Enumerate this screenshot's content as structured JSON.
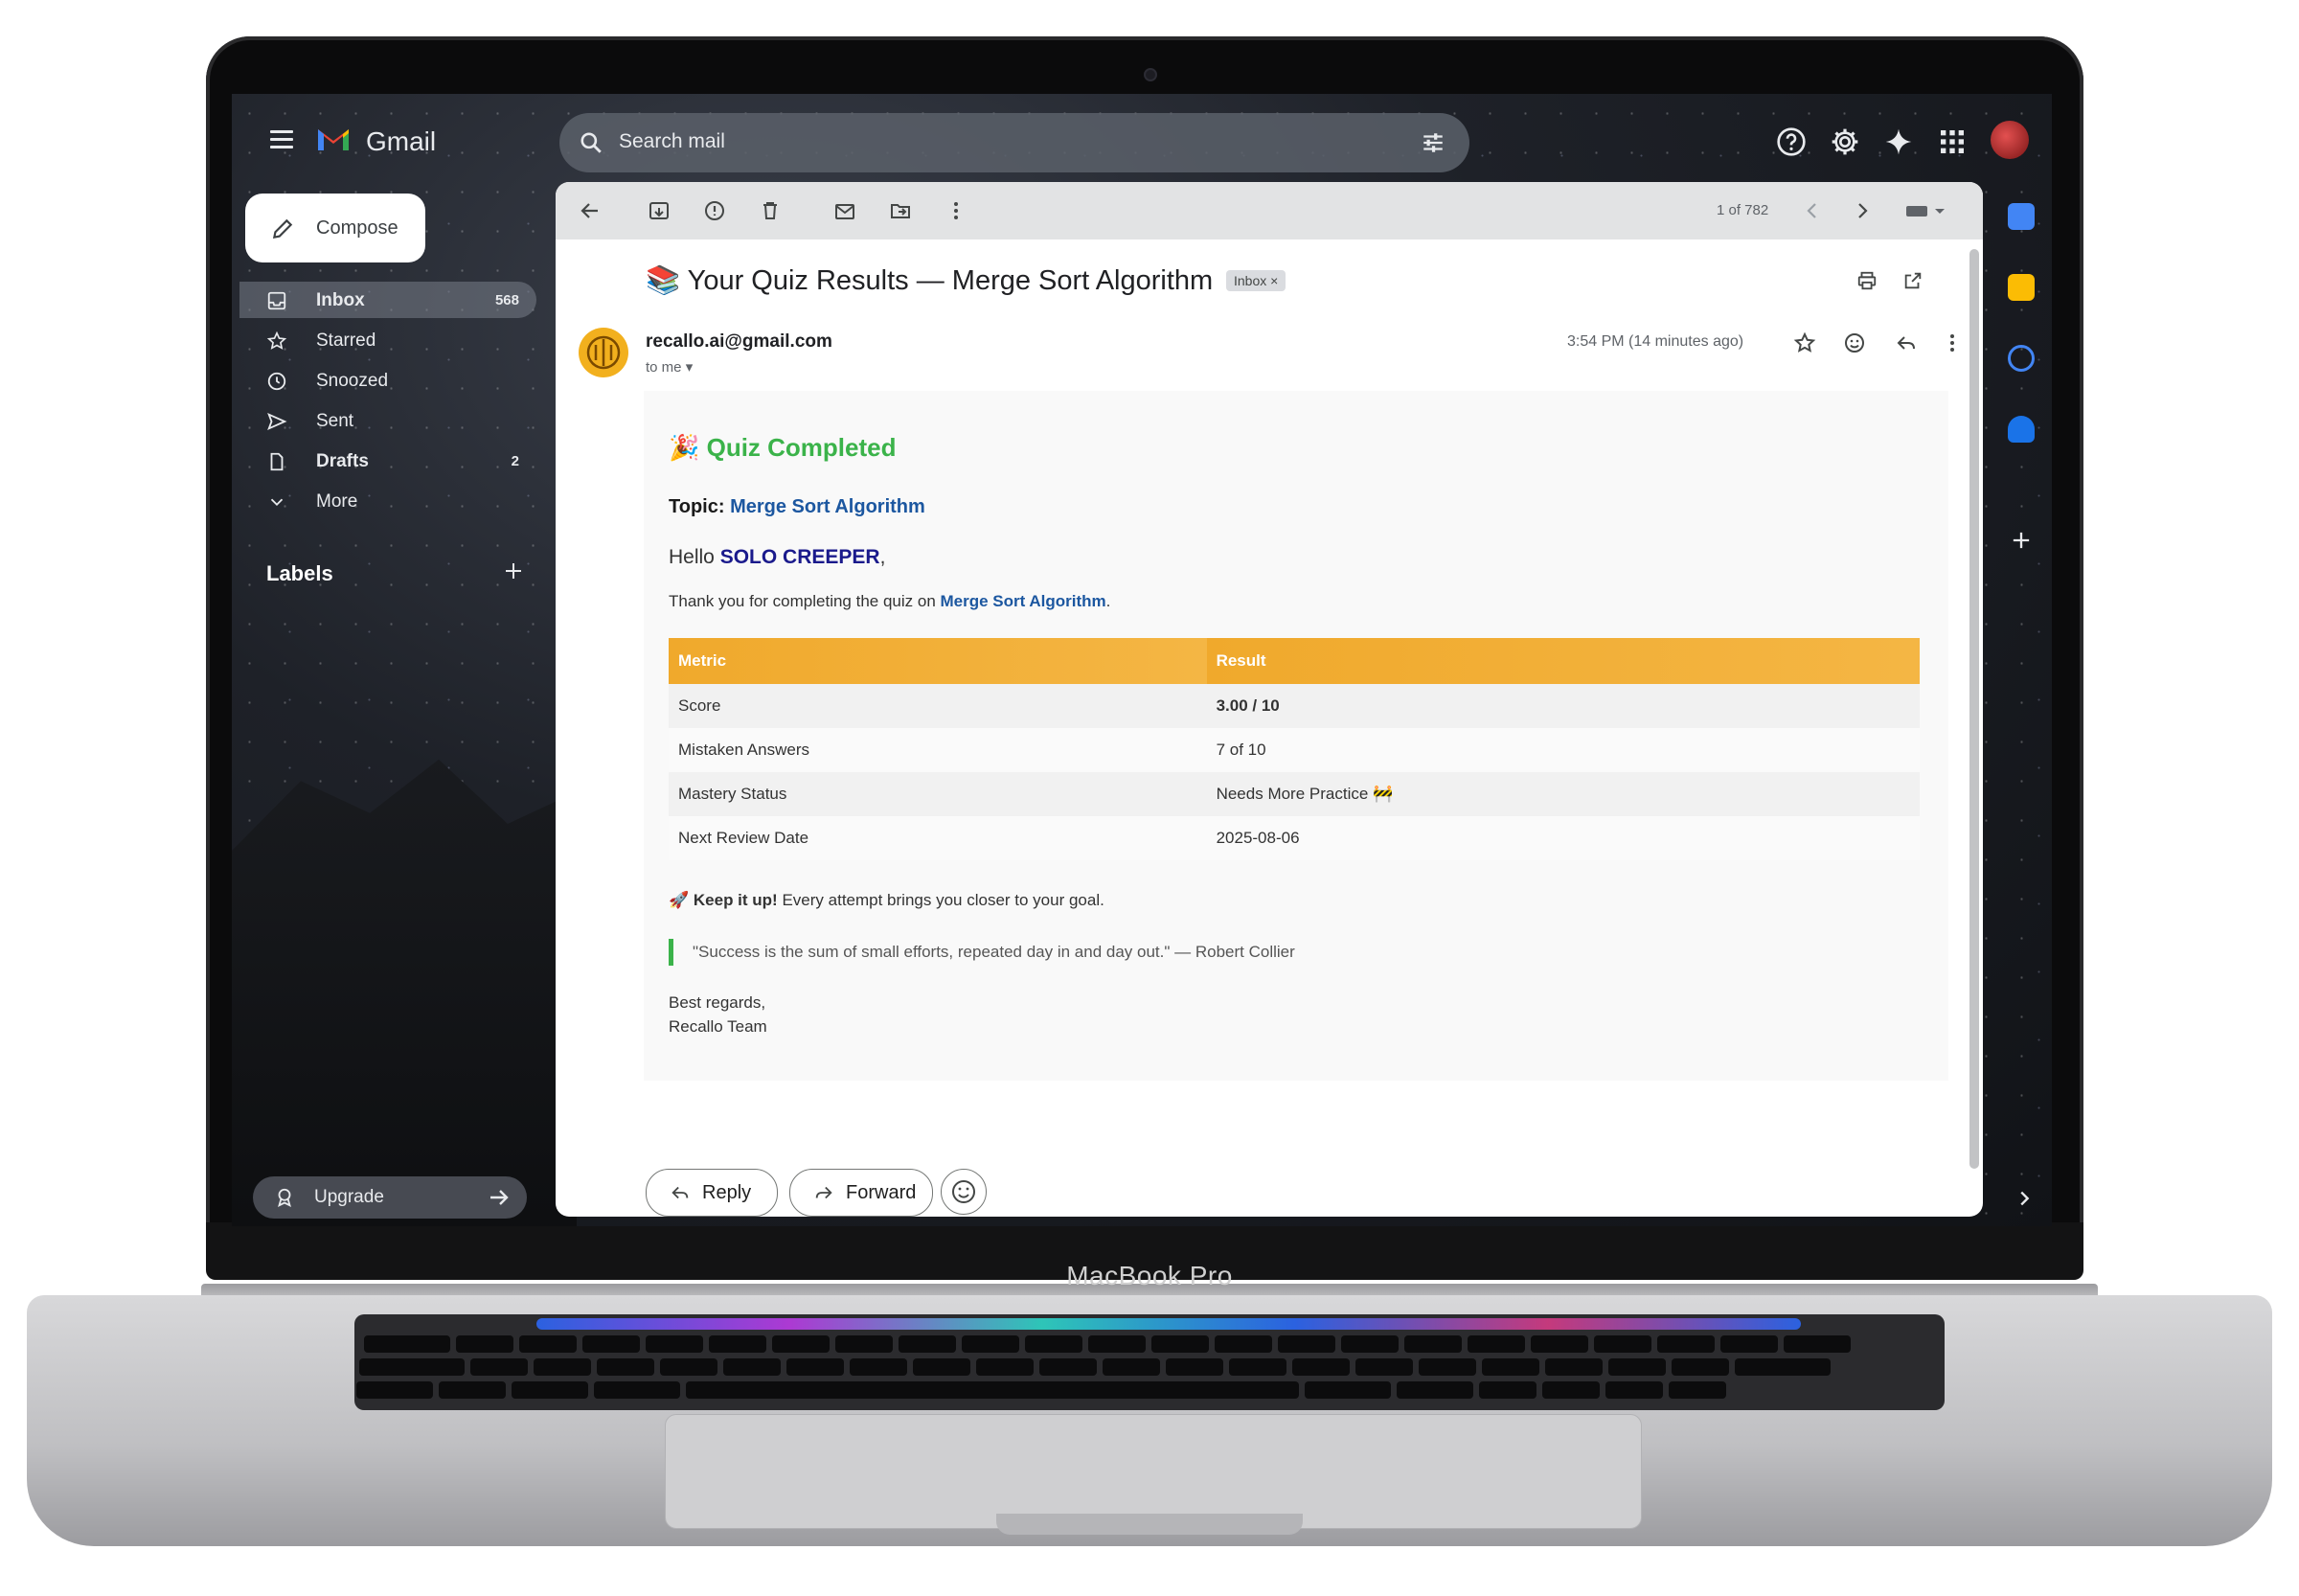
{
  "device": {
    "brand": "MacBook Pro"
  },
  "gmail": {
    "app_name": "Gmail",
    "search": {
      "placeholder": "Search mail"
    },
    "compose_label": "Compose",
    "nav": [
      {
        "label": "Inbox",
        "count": "568",
        "icon": "inbox-icon",
        "active": true,
        "bold": true
      },
      {
        "label": "Starred",
        "count": "",
        "icon": "star-icon"
      },
      {
        "label": "Snoozed",
        "count": "",
        "icon": "clock-icon"
      },
      {
        "label": "Sent",
        "count": "",
        "icon": "send-icon"
      },
      {
        "label": "Drafts",
        "count": "2",
        "icon": "draft-icon",
        "bold": true
      },
      {
        "label": "More",
        "count": "",
        "icon": "chevron-down-icon"
      }
    ],
    "labels_title": "Labels",
    "upgrade_label": "Upgrade"
  },
  "message": {
    "pager": "1 of 782",
    "subject": "📚 Your Quiz Results — Merge Sort Algorithm",
    "inbox_chip": "Inbox ×",
    "sender": "recallo.ai@gmail.com",
    "to": "to me",
    "time": "3:54 PM (14 minutes ago)",
    "body": {
      "title": "🎉 Quiz Completed",
      "topic_label": "Topic:",
      "topic_value": "Merge Sort Algorithm",
      "hello": "Hello",
      "name": "SOLO CREEPER",
      "hello_end": ",",
      "thanks_text": "Thank you for completing the quiz on",
      "thanks_topic": "Merge Sort Algorithm",
      "thanks_end": ".",
      "table_headers": [
        "Metric",
        "Result"
      ],
      "rows": [
        {
          "metric": "Score",
          "result": "3.00 / 10"
        },
        {
          "metric": "Mistaken Answers",
          "result": "7 of 10"
        },
        {
          "metric": "Mastery Status",
          "result": "Needs More Practice 🚧"
        },
        {
          "metric": "Next Review Date",
          "result": "2025-08-06"
        }
      ],
      "keepup_bold": "🚀 Keep it up!",
      "keepup_text": " Every attempt brings you closer to your goal.",
      "quote": "\"Success is the sum of small efforts, repeated day in and day out.\" — Robert Collier",
      "regards_line1": "Best regards,",
      "regards_line2": "Recallo Team"
    },
    "actions": {
      "reply": "Reply",
      "forward": "Forward"
    }
  },
  "colors": {
    "accent_green": "#3bb34a",
    "table_header": "#f0a92c",
    "link_blue": "#1c57a0",
    "status_red": "#d14013"
  }
}
